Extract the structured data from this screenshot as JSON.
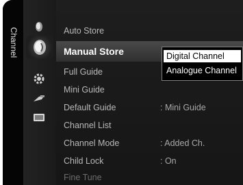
{
  "side_label": "Channel",
  "side_icons": [
    {
      "name": "picture-icon"
    },
    {
      "name": "sound-icon"
    },
    {
      "name": "channel-icon"
    },
    {
      "name": "setup-icon"
    },
    {
      "name": "input-icon"
    },
    {
      "name": "application-icon"
    }
  ],
  "menu": {
    "items": [
      {
        "label": "Auto Store",
        "value": ""
      },
      {
        "label": "Manual Store",
        "value": ""
      },
      {
        "label": "Full Guide",
        "value": ""
      },
      {
        "label": "Mini Guide",
        "value": ""
      },
      {
        "label": "Default Guide",
        "value": ": Mini Guide"
      },
      {
        "label": "Channel List",
        "value": ""
      },
      {
        "label": "Channel Mode",
        "value": ": Added Ch."
      },
      {
        "label": "Child Lock",
        "value": ": On"
      },
      {
        "label": "Fine Tune",
        "value": ""
      }
    ]
  },
  "popup": {
    "options": [
      "Digital Channel",
      "Analogue Channel"
    ]
  },
  "colors": {
    "background": "#161616",
    "selected_bar": "#3c3c3c",
    "popup_highlight": "#ffffff"
  }
}
